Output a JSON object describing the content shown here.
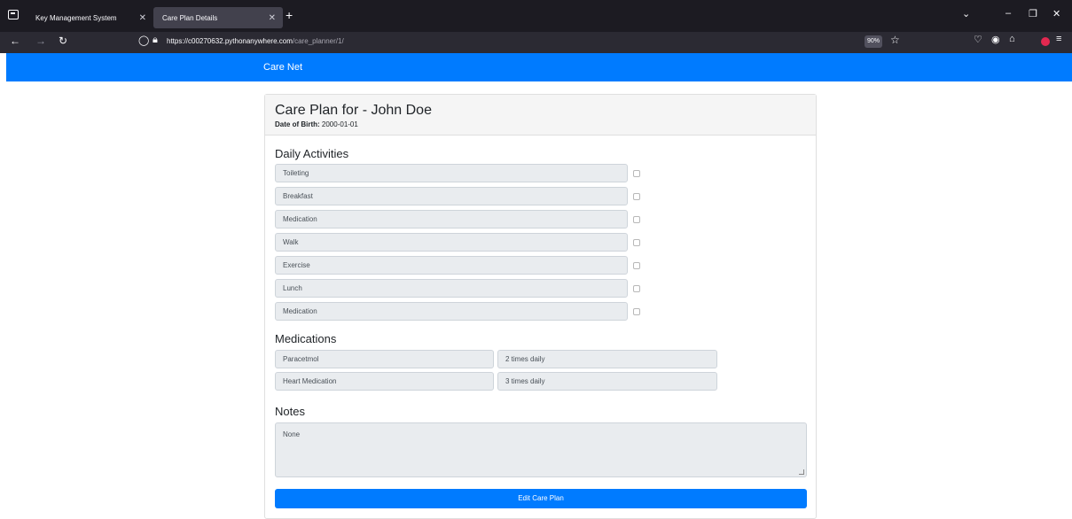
{
  "browser": {
    "tabs": [
      {
        "label": "Key Management System"
      },
      {
        "label": "Care Plan Details"
      }
    ],
    "new_tab": "+",
    "url_domain": "https://c00270632.pythonanywhere.com",
    "url_path": "/care_planner/1/",
    "zoom": "90%"
  },
  "app": {
    "brand": "Care Net"
  },
  "care_plan": {
    "title": "Care Plan for - John Doe",
    "dob_label": "Date of Birth:",
    "dob_value": "2000-01-01",
    "daily_activities_heading": "Daily Activities",
    "activities": [
      {
        "name": "Toileting",
        "done": false
      },
      {
        "name": "Breakfast",
        "done": false
      },
      {
        "name": "Medication",
        "done": false
      },
      {
        "name": "Walk",
        "done": false
      },
      {
        "name": "Exercise",
        "done": false
      },
      {
        "name": "Lunch",
        "done": false
      },
      {
        "name": "Medication",
        "done": false
      }
    ],
    "medications_heading": "Medications",
    "medications": [
      {
        "name": "Paracetmol",
        "frequency": "2 times daily"
      },
      {
        "name": "Heart Medication",
        "frequency": "3 times daily"
      }
    ],
    "notes_heading": "Notes",
    "notes_value": "None",
    "edit_button": "Edit Care Plan"
  },
  "colors": {
    "primary": "#007bff",
    "chrome_dark": "#1c1b22",
    "readonly_field": "#e9ecef"
  }
}
